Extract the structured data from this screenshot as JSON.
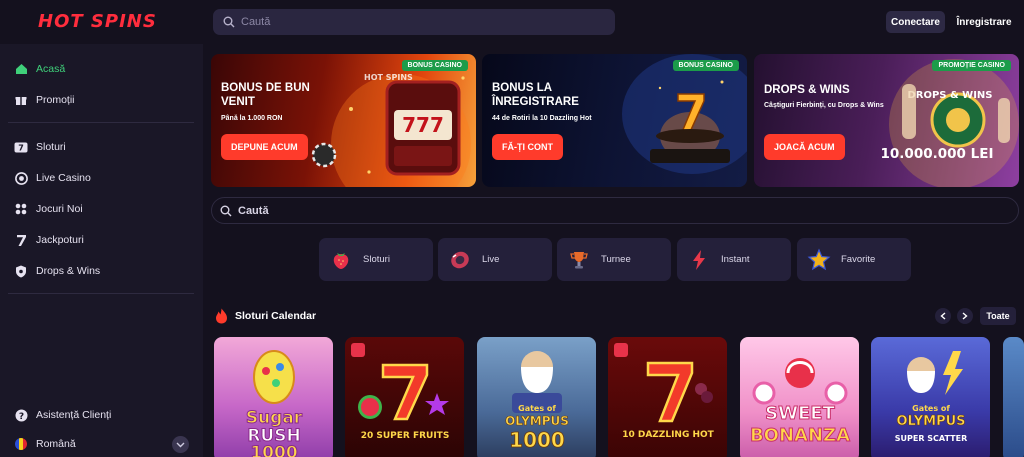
{
  "brand": {
    "logo_text": "HOT SPINS"
  },
  "header": {
    "search_placeholder": "Caută",
    "login_label": "Conectare",
    "register_label": "Înregistrare"
  },
  "sidebar": {
    "items": [
      {
        "label": "Acasă",
        "icon": "home-icon",
        "active": true
      },
      {
        "label": "Promoții",
        "icon": "gift-icon"
      },
      {
        "label": "Sloturi",
        "icon": "slot-icon"
      },
      {
        "label": "Live Casino",
        "icon": "chip-icon"
      },
      {
        "label": "Jocuri Noi",
        "icon": "grid-icon"
      },
      {
        "label": "Jackpoturi",
        "icon": "seven-icon"
      },
      {
        "label": "Drops & Wins",
        "icon": "shield-icon"
      }
    ],
    "support_label": "Asistență Clienți",
    "language_label": "Română"
  },
  "banners": [
    {
      "tag": "BONUS CASINO",
      "title": "BONUS DE BUN VENIT",
      "subtitle": "Până la 1.000 RON",
      "cta": "DEPUNE ACUM",
      "art_logo": "HOT SPINS"
    },
    {
      "tag": "BONUS CASINO",
      "title": "BONUS LA ÎNREGISTRARE",
      "subtitle": "44 de Rotiri la 10 Dazzling Hot",
      "cta": "FĂ-ȚI CONT"
    },
    {
      "tag": "PROMOȚIE CASINO",
      "title": "DROPS & WINS",
      "subtitle": "Câștiguri Fierbinți, cu Drops & Wins",
      "cta": "JOACĂ ACUM",
      "art_logo": "DROPS & WINS",
      "prize": "10.000.000 LEI"
    }
  ],
  "search2": {
    "placeholder": "Caută"
  },
  "categories": [
    {
      "label": "Sloturi",
      "icon": "strawberry-icon"
    },
    {
      "label": "Live",
      "icon": "roulette-chip-icon"
    },
    {
      "label": "Turnee",
      "icon": "trophy-icon"
    },
    {
      "label": "Instant",
      "icon": "lightning-icon"
    },
    {
      "label": "Favorite",
      "icon": "star-icon"
    }
  ],
  "section": {
    "title": "Sloturi Calendar",
    "see_all": "Toate"
  },
  "games": [
    {
      "name": "Sugar Rush 1000"
    },
    {
      "name": "20 Super Fruits"
    },
    {
      "name": "Gates of Olympus 1000"
    },
    {
      "name": "10 Dazzling Hot"
    },
    {
      "name": "Sweet Bonanza"
    },
    {
      "name": "Gates of Olympus Super Scatter"
    }
  ],
  "game_art_text": {
    "sugar": [
      "Sugar",
      "RUSH",
      "1000"
    ],
    "fruits": [
      "20 SUPER FRUITS"
    ],
    "gates": [
      "Gates of",
      "OLYMPUS",
      "1000"
    ],
    "dazzling": [
      "10 DAZZLING HOT"
    ],
    "sweet": [
      "SWEET",
      "BONANZA"
    ],
    "gates_ss": [
      "Gates of",
      "OLYMPUS",
      "SUPER SCATTER"
    ]
  },
  "colors": {
    "accent_red": "#ff3b2b",
    "active_green": "#3fd07a",
    "tag_green": "#1c9c4a",
    "bg": "#14111e",
    "sidebar_bg": "#1a1727"
  }
}
